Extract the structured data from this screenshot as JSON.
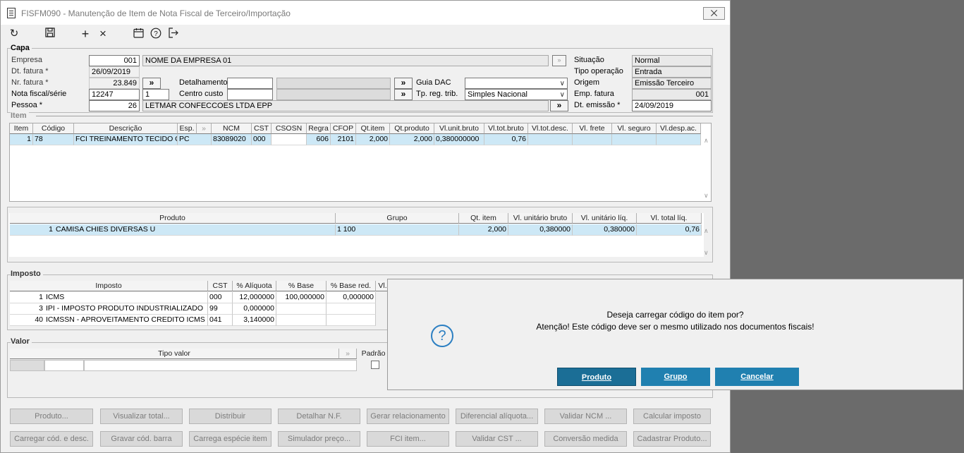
{
  "window": {
    "title": "FISFM090 - Manutenção de Item de Nota Fiscal de Terceiro/Importação",
    "close_label": "⨉"
  },
  "toolbar": {
    "icons": [
      "refresh-icon",
      "save-icon",
      "add-icon",
      "delete-icon",
      "calendar-icon",
      "help-icon",
      "exit-icon"
    ]
  },
  "capa": {
    "title": "Capa",
    "empresa_label": "Empresa",
    "empresa_code": "001",
    "empresa_name": "NOME DA EMPRESA 01",
    "dt_fatura_label": "Dt. fatura *",
    "dt_fatura": "26/09/2019",
    "nr_fatura_label": "Nr. fatura *",
    "nr_fatura": "23.849",
    "nota_label": "Nota fiscal/série",
    "nota_numero": "12247",
    "nota_serie": "1",
    "pessoa_label": "Pessoa *",
    "pessoa_code": "26",
    "pessoa_name": "LETMAR CONFECCOES LTDA EPP",
    "detalhamento_label": "Detalhamento",
    "detalhamento_value": "",
    "centro_custo_label": "Centro custo",
    "centro_custo_value": "",
    "guia_dac_label": "Guia DAC",
    "guia_dac_value": "",
    "tp_reg_label": "Tp. reg. trib.",
    "tp_reg_value": "Simples Nacional",
    "situacao_label": "Situação",
    "situacao": "Normal",
    "tipo_operacao_label": "Tipo operação",
    "tipo_operacao": "Entrada",
    "origem_label": "Origem",
    "origem": "Emissão Terceiro",
    "emp_fatura_label": "Emp. fatura",
    "emp_fatura": "001",
    "dt_emissao_label": "Dt. emissão *",
    "dt_emissao": "24/09/2019",
    "expand_label": "»"
  },
  "item": {
    "title": "Item",
    "columns": [
      "Item",
      "Código",
      "Descrição",
      "Esp.",
      "",
      "NCM",
      "CST",
      "CSOSN",
      "Regra",
      "CFOP",
      "Qt.item",
      "Qt.produto",
      "Vl.unit.bruto",
      "Vl.tot.bruto",
      "Vl.tot.desc.",
      "Vl. frete",
      "Vl. seguro",
      "Vl.desp.ac."
    ],
    "rows": [
      [
        "1",
        "78",
        "FCI TREINAMENTO TECIDO CC",
        "PC",
        "",
        "83089020",
        "000",
        "",
        "606",
        "2101",
        "2,000",
        "2,000",
        "0,380000000",
        "0,76",
        "",
        "",
        "",
        ""
      ]
    ]
  },
  "produto_grid": {
    "columns": [
      "Produto",
      "Grupo",
      "Qt. item",
      "Vl. unitário bruto",
      "Vl. unitário líq.",
      "Vl. total líq."
    ],
    "rows": [
      [
        "1",
        "CAMISA CHIES DIVERSAS U",
        "1 100",
        "2,000",
        "0,380000",
        "0,380000",
        "0,76"
      ]
    ]
  },
  "imposto": {
    "title": "Imposto",
    "columns": [
      "Imposto",
      "CST",
      "% Alíquota",
      "% Base",
      "% Base red.",
      "Vl."
    ],
    "rows": [
      [
        "1",
        "ICMS",
        "000",
        "12,000000",
        "100,000000",
        "0,000000"
      ],
      [
        "3",
        "IPI - IMPOSTO PRODUTO INDUSTRIALIZADO",
        "99",
        "0,000000",
        "",
        ""
      ],
      [
        "40",
        "ICMSSN - APROVEITAMENTO CREDITO ICMS SI",
        "041",
        "3,140000",
        "",
        ""
      ]
    ]
  },
  "valor": {
    "title": "Valor",
    "columns": [
      "Tipo valor",
      "",
      "Padrão"
    ]
  },
  "buttons": {
    "row1": [
      "Produto...",
      "Visualizar total...",
      "Distribuir",
      "Detalhar N.F.",
      "Gerar relacionamento",
      "Diferencial alíquota...",
      "Validar NCM ...",
      "Calcular imposto"
    ],
    "row2": [
      "Carregar cód. e desc.",
      "Gravar cód. barra",
      "Carrega espécie item",
      "Simulador preço...",
      "FCI item...",
      "Validar CST ...",
      "Conversão medida",
      "Cadastrar Produto..."
    ]
  },
  "dialog": {
    "icon": "question-icon",
    "line1": "Deseja carregar código do item por?",
    "line2": "Atenção! Este código deve ser o mesmo utilizado nos documentos fiscais!",
    "btn_produto": "Produto",
    "btn_grupo": "Grupo",
    "btn_cancelar": "Cancelar"
  }
}
